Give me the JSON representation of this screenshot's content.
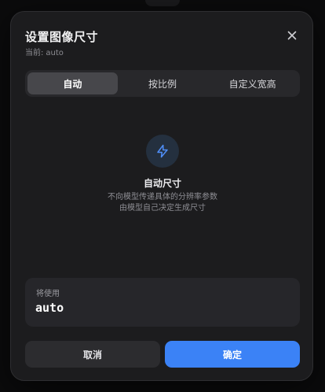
{
  "dialog": {
    "title": "设置图像尺寸",
    "current_label": "当前:",
    "current_value": "auto"
  },
  "tabs": [
    {
      "label": "自动",
      "active": true
    },
    {
      "label": "按比例",
      "active": false
    },
    {
      "label": "自定义宽高",
      "active": false
    }
  ],
  "auto_panel": {
    "icon": "lightning-bolt-icon",
    "title": "自动尺寸",
    "desc_line1": "不向模型传递具体的分辨率参数",
    "desc_line2": "由模型自己决定生成尺寸"
  },
  "using": {
    "label": "将使用",
    "value": "auto"
  },
  "actions": {
    "cancel_label": "取消",
    "confirm_label": "确定"
  },
  "colors": {
    "accent": "#3b82f6",
    "dialog_bg": "#1c1c1e"
  }
}
